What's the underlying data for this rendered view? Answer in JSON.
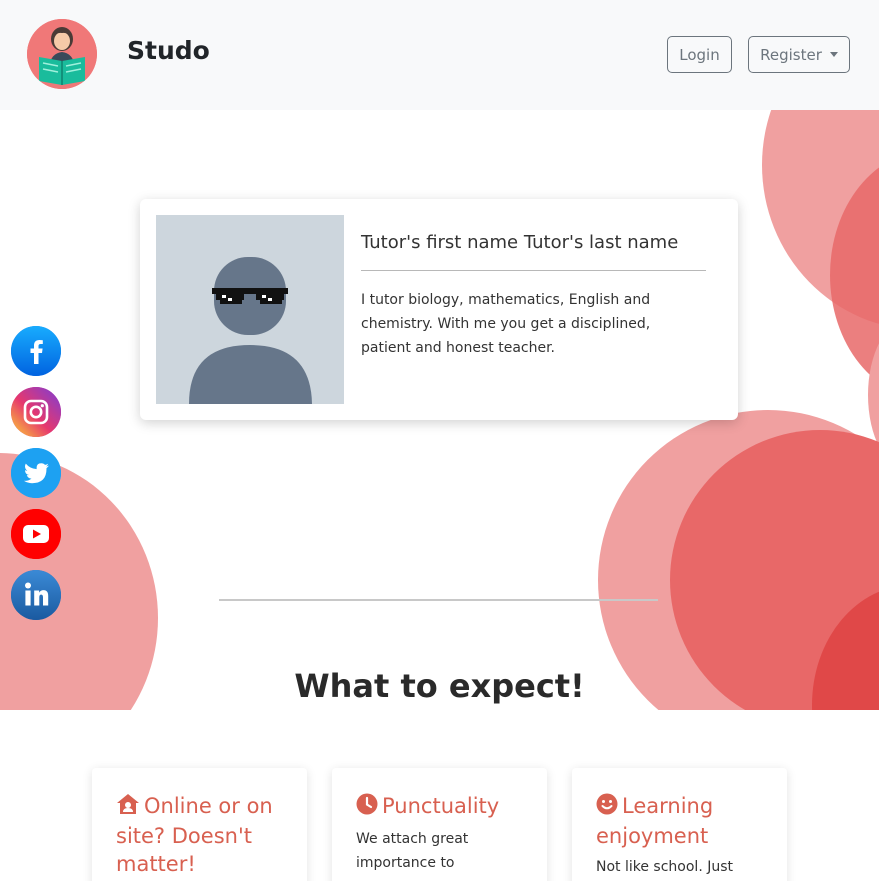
{
  "navbar": {
    "brand": "Studo",
    "login_label": "Login",
    "register_label": "Register",
    "logo_icon": "reading-woman-icon"
  },
  "tutor": {
    "name": "Tutor's first name Tutor's last name",
    "bio": "I tutor biology, mathematics, English and chemistry. With me you get a disciplined, patient and honest teacher.",
    "avatar_icon": "avatar-with-sunglasses-icon"
  },
  "section": {
    "title": "What to expect!"
  },
  "social": [
    {
      "name": "facebook",
      "color": "#1877f2"
    },
    {
      "name": "instagram",
      "color": "#d6249f"
    },
    {
      "name": "twitter",
      "color": "#1da1f2"
    },
    {
      "name": "youtube",
      "color": "#ff0000"
    },
    {
      "name": "linkedin",
      "color": "#2867b2"
    }
  ],
  "features": [
    {
      "icon": "house-user-icon",
      "title": "Online or on site? Doesn't matter!",
      "text": ""
    },
    {
      "icon": "clock-icon",
      "title": "Punctuality",
      "text": "We attach great importance to"
    },
    {
      "icon": "smile-icon",
      "title": "Learning enjoyment",
      "text": "Not like school. Just"
    }
  ],
  "colors": {
    "accent": "#d86050",
    "blob_light": "#f0a0a0",
    "blob_mid": "#e86868",
    "blob_dark": "#e04848",
    "navbar_bg": "#f8f9fa"
  }
}
